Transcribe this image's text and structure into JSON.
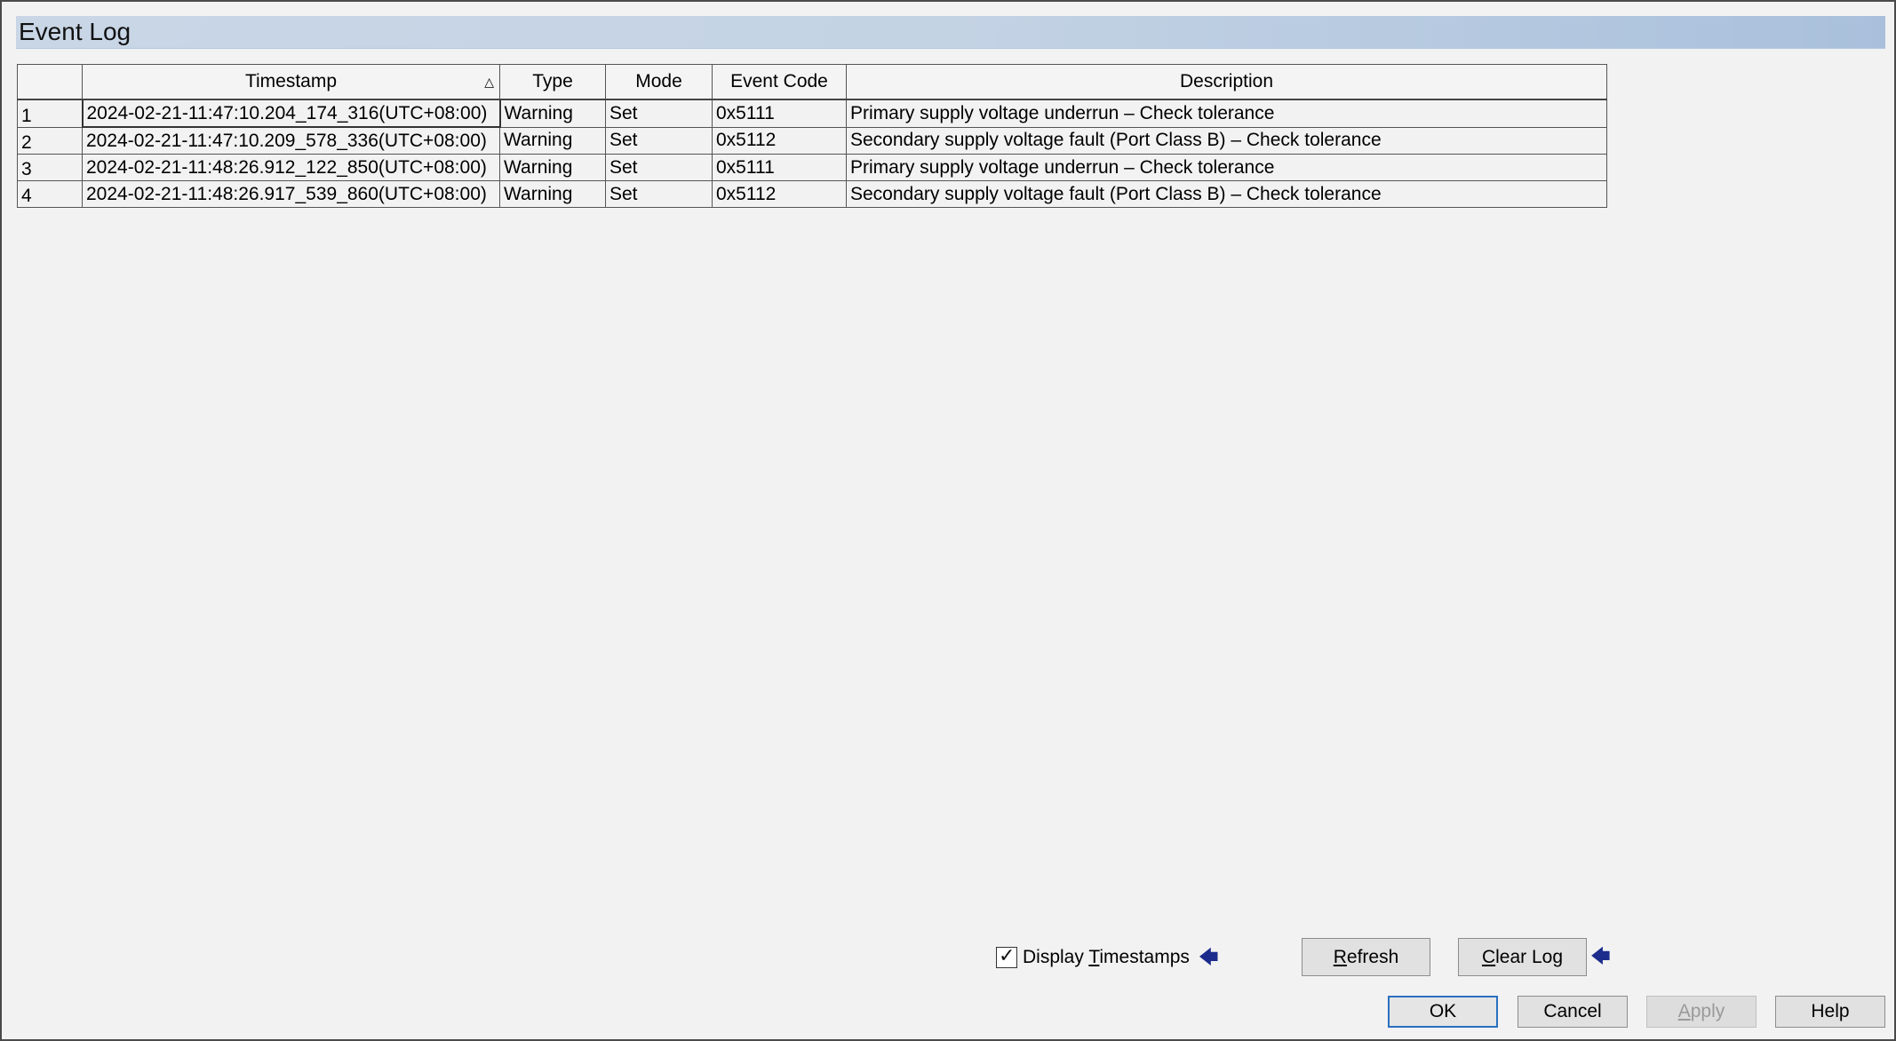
{
  "window": {
    "title": "Event Log"
  },
  "table": {
    "columns": [
      "",
      "Timestamp",
      "Type",
      "Mode",
      "Event Code",
      "Description"
    ],
    "sort_indicator": "△",
    "rows": [
      {
        "num": "1",
        "timestamp": "2024-02-21-11:47:10.204_174_316(UTC+08:00)",
        "type": "Warning",
        "mode": "Set",
        "code": "0x5111",
        "description": "Primary supply voltage underrun – Check tolerance"
      },
      {
        "num": "2",
        "timestamp": "2024-02-21-11:47:10.209_578_336(UTC+08:00)",
        "type": "Warning",
        "mode": "Set",
        "code": "0x5112",
        "description": "Secondary supply voltage fault (Port Class B) – Check tolerance"
      },
      {
        "num": "3",
        "timestamp": "2024-02-21-11:48:26.912_122_850(UTC+08:00)",
        "type": "Warning",
        "mode": "Set",
        "code": "0x5111",
        "description": "Primary supply voltage underrun – Check tolerance"
      },
      {
        "num": "4",
        "timestamp": "2024-02-21-11:48:26.917_539_860(UTC+08:00)",
        "type": "Warning",
        "mode": "Set",
        "code": "0x5112",
        "description": "Secondary supply voltage fault (Port Class B) – Check tolerance"
      }
    ]
  },
  "options": {
    "display_timestamps": {
      "prefix": "Display ",
      "accel": "T",
      "suffix": "imestamps",
      "checked": true
    }
  },
  "buttons": {
    "refresh": {
      "accel": "R",
      "rest": "efresh"
    },
    "clear_log": {
      "accel": "C",
      "rest": "lear Log"
    },
    "ok": "OK",
    "cancel": "Cancel",
    "apply": {
      "accel": "A",
      "rest": "pply"
    },
    "help": "Help"
  },
  "icons": {
    "arrow": "arrow-left-icon",
    "check": "checkmark-icon",
    "sort": "sort-ascending-icon"
  },
  "colors": {
    "title_bar": "#c4d3e4",
    "arrow": "#1c2c8c",
    "default_button_border": "#2a6fc0"
  }
}
